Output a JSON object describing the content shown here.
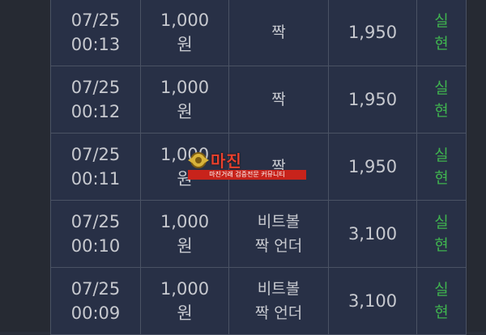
{
  "rows": [
    {
      "date": "07/25",
      "time": "00:13",
      "amount": "1,000",
      "unit": "원",
      "pick1": "짝",
      "pick2": "",
      "odds": "1,950",
      "status1": "실",
      "status2": "현"
    },
    {
      "date": "07/25",
      "time": "00:12",
      "amount": "1,000",
      "unit": "원",
      "pick1": "짝",
      "pick2": "",
      "odds": "1,950",
      "status1": "실",
      "status2": "현"
    },
    {
      "date": "07/25",
      "time": "00:11",
      "amount": "1,000",
      "unit": "원",
      "pick1": "짝",
      "pick2": "",
      "odds": "1,950",
      "status1": "실",
      "status2": "현"
    },
    {
      "date": "07/25",
      "time": "00:10",
      "amount": "1,000",
      "unit": "원",
      "pick1": "비트볼",
      "pick2": "짝 언더",
      "odds": "3,100",
      "status1": "실",
      "status2": "현"
    },
    {
      "date": "07/25",
      "time": "00:09",
      "amount": "1,000",
      "unit": "원",
      "pick1": "비트볼",
      "pick2": "짝 언더",
      "odds": "3,100",
      "status1": "실",
      "status2": "현"
    }
  ],
  "watermark": {
    "title": "마진",
    "subtitle": "마진거래 검증전문 커뮤니티"
  },
  "colors": {
    "background": "#2b2f38",
    "table": "#283046",
    "text": "#c7c9cf",
    "status": "#3fb34f",
    "watermark": "#e8412e"
  }
}
